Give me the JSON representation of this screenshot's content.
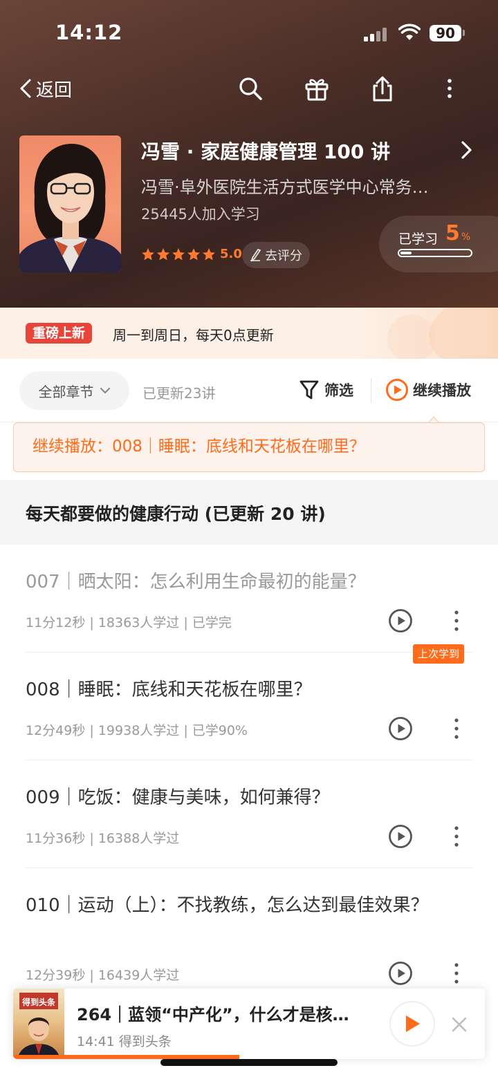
{
  "status_bar": {
    "time": "14:12",
    "battery": "90"
  },
  "nav": {
    "back_label": "返回"
  },
  "course": {
    "title": "冯雪 · 家庭健康管理 100 讲",
    "author": "冯雪·阜外医院生活方式医学中心常务…",
    "learners": "25445人加入学习",
    "rating": "5.0",
    "stars": 5,
    "rate_label": "去评分",
    "progress_label": "已学习",
    "progress_value": "5",
    "progress_unit": "%",
    "progress_fraction": 0.05
  },
  "notice": {
    "badge": "重磅上新",
    "text": "周一到周日，每天0点更新"
  },
  "toolbar": {
    "chapter_select": "全部章节",
    "updated_count": "已更新23讲",
    "filter_label": "筛选",
    "continue_label": "继续播放"
  },
  "resume_bar": {
    "text": "继续播放：008｜睡眠：底线和天花板在哪里？"
  },
  "section": {
    "title": "每天都要做的健康行动 (已更新 20 讲)"
  },
  "lessons": [
    {
      "title": "007｜晒太阳：怎么利用生命最初的能量？",
      "meta": "11分12秒 | 18363人学过 | 已学完",
      "completed": true
    },
    {
      "title": "008｜睡眠：底线和天花板在哪里？",
      "meta": "12分49秒 | 19938人学过 | 已学90%",
      "badge": "上次学到"
    },
    {
      "title": "009｜吃饭：健康与美味，如何兼得？",
      "meta": "11分36秒 | 16388人学过"
    },
    {
      "title": "010｜运动（上）：不找教练，怎么达到最佳效果？",
      "meta": "12分39秒 | 16439人学过"
    }
  ],
  "mini_player": {
    "title": "264｜蓝领“中产化”，什么才是核…",
    "subtitle": "14:41 得到头条",
    "thumb_text": "得到头条",
    "progress_fraction": 0.48
  },
  "colors": {
    "accent": "#ff6b1a",
    "star": "#ff7a2e",
    "hero_bg": "#4a2e27",
    "badge_red": "#e8453a"
  },
  "icons": [
    "chevron-left-icon",
    "search-icon",
    "gift-icon",
    "share-icon",
    "more-vertical-icon",
    "chevron-right-icon",
    "star-icon",
    "pencil-icon",
    "chevron-down-icon",
    "filter-icon",
    "play-circle-icon",
    "close-icon"
  ]
}
